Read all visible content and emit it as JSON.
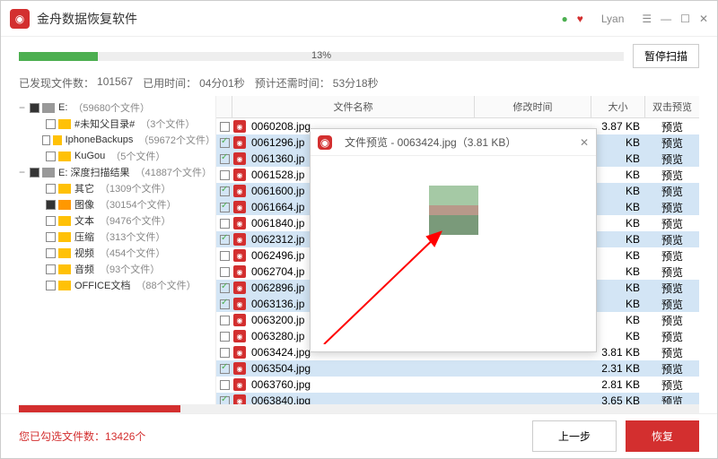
{
  "app": {
    "title": "金舟数据恢复软件",
    "user": "Lyan"
  },
  "progress": {
    "percent": 13,
    "pause_btn": "暂停扫描"
  },
  "stats": {
    "found_label": "已发现文件数：",
    "found_count": "101567",
    "elapsed_label": "已用时间：",
    "elapsed": "04分01秒",
    "remain_label": "预计还需时间：",
    "remain": "53分18秒"
  },
  "tree": [
    {
      "indent": 0,
      "toggle": "−",
      "cb": "partial",
      "icon": "disk",
      "label": "E:",
      "count": "（59680个文件）"
    },
    {
      "indent": 1,
      "toggle": "",
      "cb": "",
      "icon": "folder",
      "label": "#未知父目录#",
      "count": "（3个文件）"
    },
    {
      "indent": 1,
      "toggle": "",
      "cb": "",
      "icon": "folder",
      "label": "IphoneBackups",
      "count": "（59672个文件）"
    },
    {
      "indent": 1,
      "toggle": "",
      "cb": "",
      "icon": "folder",
      "label": "KuGou",
      "count": "（5个文件）"
    },
    {
      "indent": 0,
      "toggle": "−",
      "cb": "partial",
      "icon": "disk",
      "label": "E: 深度扫描结果",
      "count": "（41887个文件）"
    },
    {
      "indent": 1,
      "toggle": "",
      "cb": "",
      "icon": "folder",
      "label": "其它",
      "count": "（1309个文件）"
    },
    {
      "indent": 1,
      "toggle": "",
      "cb": "partial",
      "icon": "folder-orange",
      "label": "图像",
      "count": "（30154个文件）"
    },
    {
      "indent": 1,
      "toggle": "",
      "cb": "",
      "icon": "folder",
      "label": "文本",
      "count": "（9476个文件）"
    },
    {
      "indent": 1,
      "toggle": "",
      "cb": "",
      "icon": "folder",
      "label": "压缩",
      "count": "（313个文件）"
    },
    {
      "indent": 1,
      "toggle": "",
      "cb": "",
      "icon": "folder",
      "label": "视频",
      "count": "（454个文件）"
    },
    {
      "indent": 1,
      "toggle": "",
      "cb": "",
      "icon": "folder",
      "label": "音频",
      "count": "（93个文件）"
    },
    {
      "indent": 1,
      "toggle": "",
      "cb": "",
      "icon": "folder",
      "label": "OFFICE文档",
      "count": "（88个文件）"
    }
  ],
  "columns": {
    "name": "文件名称",
    "time": "修改时间",
    "size": "大小",
    "preview": "双击预览"
  },
  "files": [
    {
      "checked": false,
      "name": "0060208.jpg",
      "size": "3.87 KB",
      "prev": "预览",
      "sel": false
    },
    {
      "checked": true,
      "name": "0061296.jp",
      "size": "KB",
      "prev": "预览",
      "sel": true
    },
    {
      "checked": true,
      "name": "0061360.jp",
      "size": "KB",
      "prev": "预览",
      "sel": true
    },
    {
      "checked": false,
      "name": "0061528.jp",
      "size": "KB",
      "prev": "预览",
      "sel": false
    },
    {
      "checked": true,
      "name": "0061600.jp",
      "size": "KB",
      "prev": "预览",
      "sel": true
    },
    {
      "checked": true,
      "name": "0061664.jp",
      "size": "KB",
      "prev": "预览",
      "sel": true
    },
    {
      "checked": false,
      "name": "0061840.jp",
      "size": "KB",
      "prev": "预览",
      "sel": false
    },
    {
      "checked": true,
      "name": "0062312.jp",
      "size": "KB",
      "prev": "预览",
      "sel": true
    },
    {
      "checked": false,
      "name": "0062496.jp",
      "size": "KB",
      "prev": "预览",
      "sel": false
    },
    {
      "checked": false,
      "name": "0062704.jp",
      "size": "KB",
      "prev": "预览",
      "sel": false
    },
    {
      "checked": true,
      "name": "0062896.jp",
      "size": "KB",
      "prev": "预览",
      "sel": true
    },
    {
      "checked": true,
      "name": "0063136.jp",
      "size": "KB",
      "prev": "预览",
      "sel": true
    },
    {
      "checked": false,
      "name": "0063200.jp",
      "size": "KB",
      "prev": "预览",
      "sel": false
    },
    {
      "checked": false,
      "name": "0063280.jp",
      "size": "KB",
      "prev": "预览",
      "sel": false
    },
    {
      "checked": false,
      "name": "0063424.jpg",
      "size": "3.81 KB",
      "prev": "预览",
      "sel": false
    },
    {
      "checked": true,
      "name": "0063504.jpg",
      "size": "2.31 KB",
      "prev": "预览",
      "sel": true
    },
    {
      "checked": false,
      "name": "0063760.jpg",
      "size": "2.81 KB",
      "prev": "预览",
      "sel": false
    },
    {
      "checked": true,
      "name": "0063840.jpg",
      "size": "3.65 KB",
      "prev": "预览",
      "sel": true
    }
  ],
  "popup": {
    "title": "文件预览 - 0063424.jpg（3.81 KB）"
  },
  "footer": {
    "selected_label": "您已勾选文件数：",
    "selected_count": "13426个",
    "prev_btn": "上一步",
    "recover_btn": "恢复"
  }
}
